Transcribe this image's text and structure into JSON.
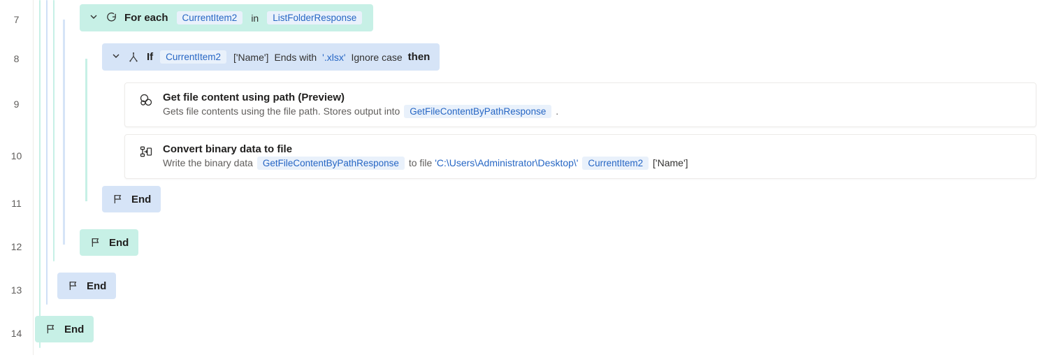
{
  "lines": {
    "l7": "7",
    "l8": "8",
    "l9": "9",
    "l10": "10",
    "l11": "11",
    "l12": "12",
    "l13": "13",
    "l14": "14"
  },
  "foreach": {
    "keyword": "For each",
    "item_var": "CurrentItem2",
    "in_keyword": "in",
    "collection_var": "ListFolderResponse"
  },
  "if_block": {
    "keyword": "If",
    "var": "CurrentItem2",
    "prop": "['Name']",
    "op": "Ends with",
    "value": "'.xlsx'",
    "flag": "Ignore case",
    "then": "then"
  },
  "action_get": {
    "title": "Get file content using path (Preview)",
    "desc_pre": "Gets file contents using the file path. Stores output into",
    "out_var": "GetFileContentByPathResponse",
    "desc_post": "."
  },
  "action_convert": {
    "title": "Convert binary data to file",
    "desc_pre": "Write the binary data",
    "in_var": "GetFileContentByPathResponse",
    "mid": "to file",
    "path_literal": "'C:\\Users\\Administrator\\Desktop\\'",
    "item_var": "CurrentItem2",
    "prop": "['Name']"
  },
  "end": {
    "label": "End"
  }
}
